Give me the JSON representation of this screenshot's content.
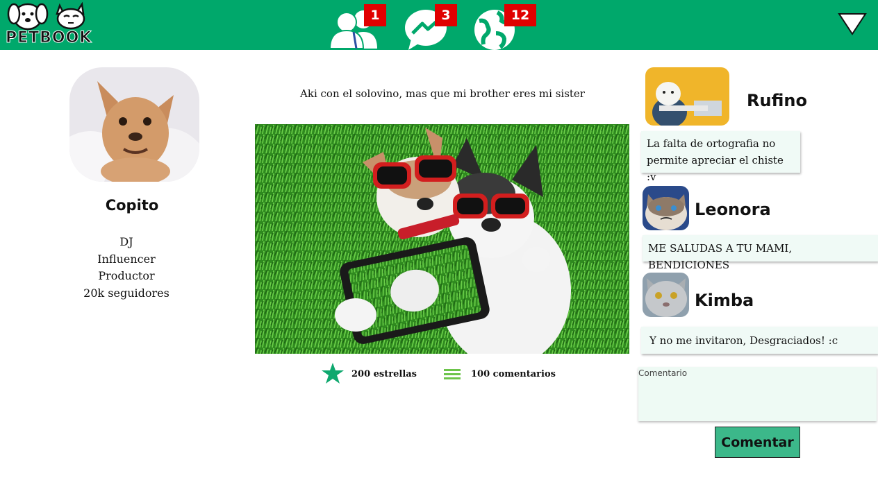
{
  "header": {
    "logo_text": "PETBOOK",
    "nav": [
      {
        "name": "friends",
        "icon": "friends-icon",
        "count": "1"
      },
      {
        "name": "messages",
        "icon": "messenger-icon",
        "count": "3"
      },
      {
        "name": "notifications",
        "icon": "globe-icon",
        "count": "12"
      }
    ],
    "menu_icon": "triangle-down-icon"
  },
  "colors": {
    "brand": "#00a86b",
    "badge": "#e00000",
    "button": "#3cb88a",
    "bubble": "#f0faf6"
  },
  "profile": {
    "name": "Copito",
    "info": [
      "DJ",
      "Influencer",
      "Productor",
      "20k seguidores"
    ]
  },
  "post": {
    "caption": "Aki con el solovino, mas que mi brother eres mi sister",
    "stars": "200 estrellas",
    "comments": "100 comentarios"
  },
  "comments": [
    {
      "author": "Rufino",
      "text": "La falta de ortografia no permite apreciar el chiste :v"
    },
    {
      "author": "Leonora",
      "text": "ME SALUDAS A TU MAMI, BENDICIONES"
    },
    {
      "author": "Kimba",
      "text": "Y no me invitaron, Desgraciados! :c"
    }
  ],
  "new_comment": {
    "placeholder": "Comentario",
    "button": "Comentar"
  }
}
